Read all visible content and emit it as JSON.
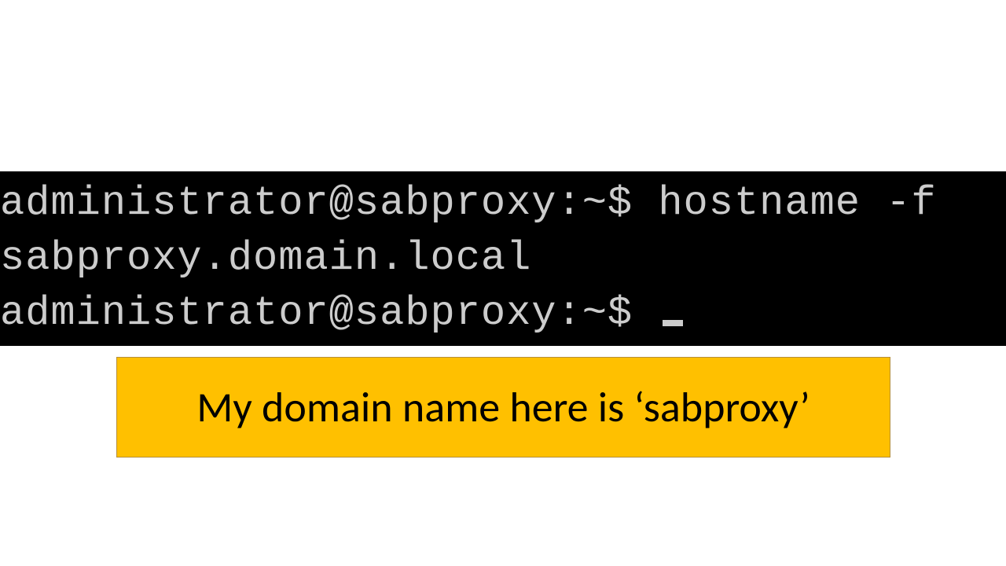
{
  "terminal": {
    "line1_prompt": "administrator@sabproxy:~$ ",
    "line1_cmd": "hostname -f",
    "line2_output": "sabproxy.domain.local",
    "line3_prompt": "administrator@sabproxy:~$ "
  },
  "callout": {
    "text": "My domain name here is ‘sabproxy’"
  }
}
